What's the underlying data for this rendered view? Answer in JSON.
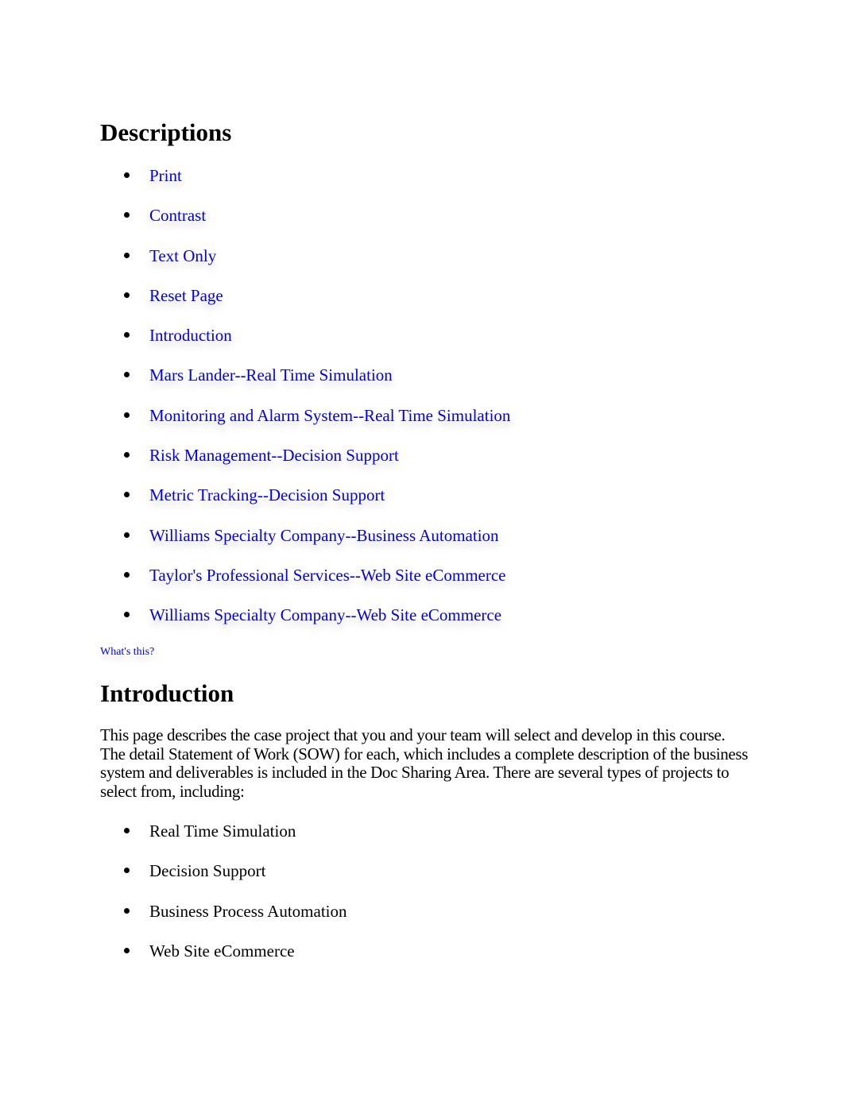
{
  "descriptions": {
    "heading": "Descriptions",
    "links": [
      {
        "label": "Print"
      },
      {
        "label": "Contrast"
      },
      {
        "label": "Text Only"
      },
      {
        "label": "Reset Page"
      },
      {
        "label": "Introduction"
      },
      {
        "label": "Mars Lander--Real Time Simulation"
      },
      {
        "label": "Monitoring and Alarm System--Real Time Simulation"
      },
      {
        "label": "Risk Management--Decision Support"
      },
      {
        "label": "Metric Tracking--Decision Support"
      },
      {
        "label": "Williams Specialty Company--Business Automation"
      },
      {
        "label": "Taylor's Professional Services--Web Site eCommerce"
      },
      {
        "label": "Williams Specialty Company--Web Site eCommerce"
      }
    ],
    "whats_this": "What's this?"
  },
  "introduction": {
    "heading": "Introduction",
    "paragraph": "This page describes the case project that you and your team will select and develop in this course. The detail Statement of Work (SOW) for each, which includes a complete description of the business system and deliverables is included in the Doc Sharing Area. There are several types of projects to select from, including:",
    "project_types": [
      "Real Time Simulation",
      "Decision Support",
      "Business Process Automation",
      "Web Site eCommerce"
    ]
  },
  "colors": {
    "link": "#0000ee",
    "text": "#000000",
    "background": "#ffffff"
  }
}
